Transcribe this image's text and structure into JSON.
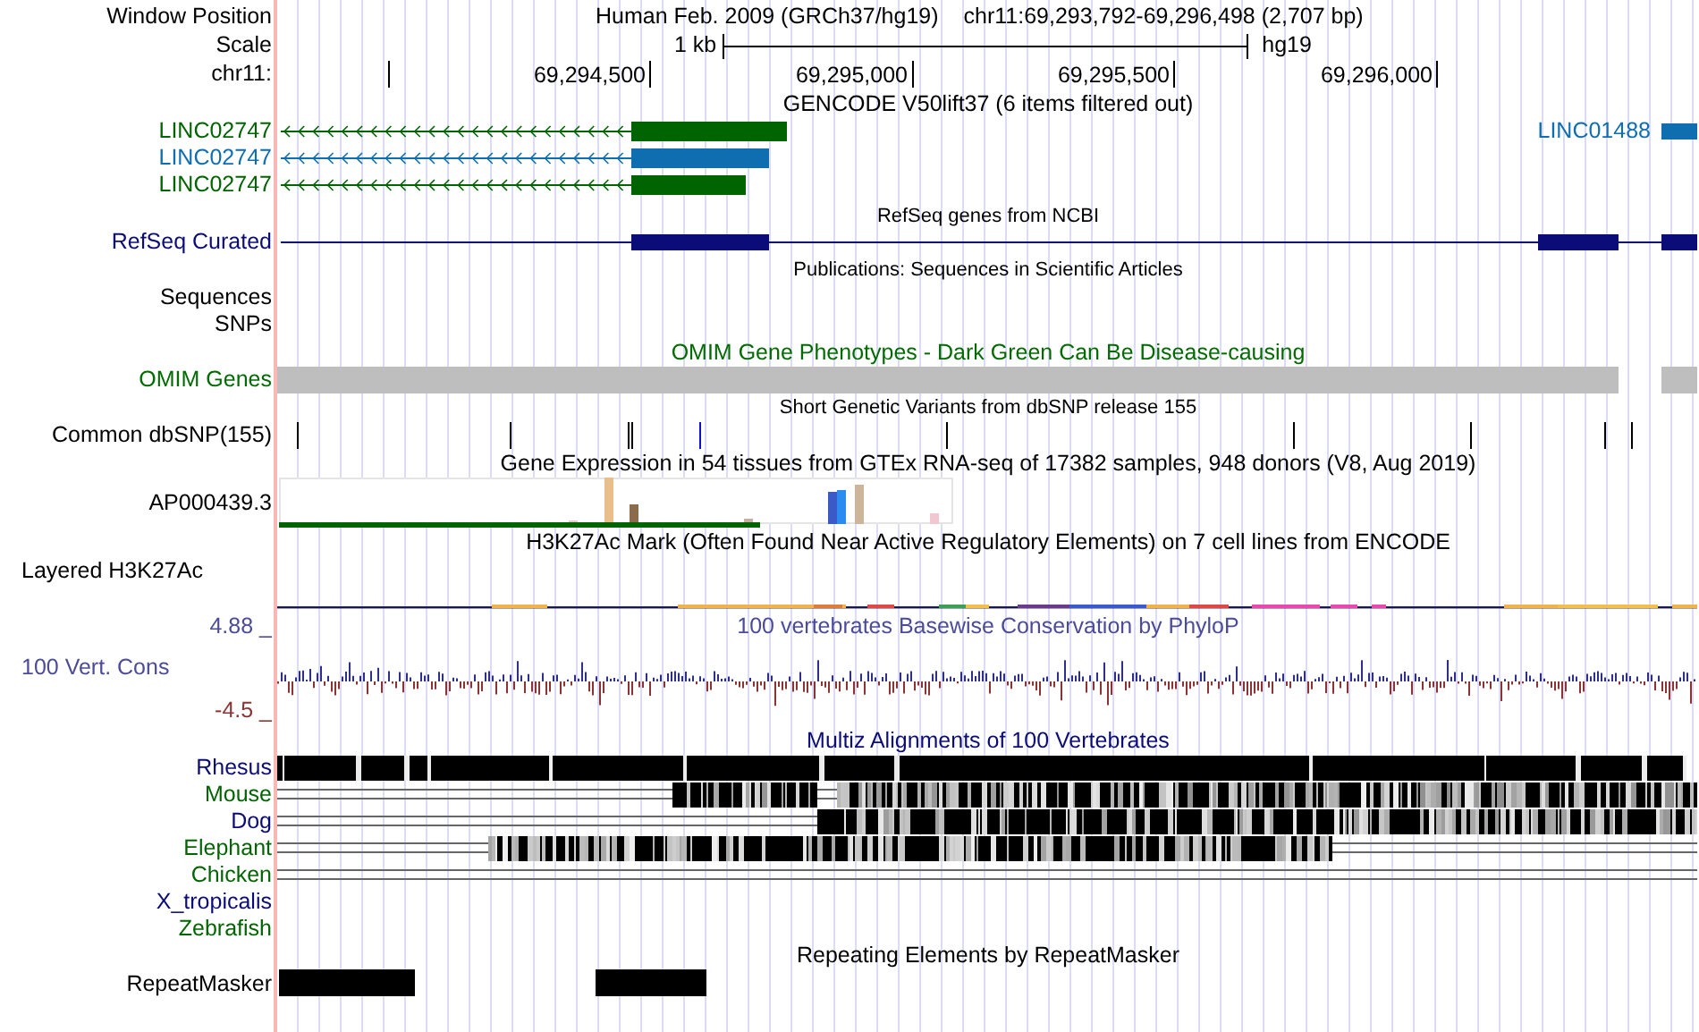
{
  "header": {
    "position_label": "Window Position",
    "assembly": "Human Feb. 2009 (GRCh37/hg19)",
    "position": "chr11:69,293,792-69,296,498 (2,707 bp)",
    "scale_label": "Scale",
    "scale_value": "1 kb",
    "scale_db": "hg19",
    "chrom_label": "chr11:",
    "ticks": [
      "69,294,500",
      "69,295,000",
      "69,295,500",
      "69,296,000"
    ]
  },
  "tracks": [
    {
      "kind": "genes",
      "title": "GENCODE V50lift37 (6 items filtered out)",
      "items": [
        {
          "label": "LINC02747",
          "color": "#006400"
        },
        {
          "label": "LINC02747",
          "color": "#0e6eb0"
        },
        {
          "label": "LINC02747",
          "color": "#006400"
        }
      ],
      "extra": {
        "label": "LINC01488",
        "color": "#0e6eb0"
      }
    },
    {
      "kind": "refseq",
      "title": "RefSeq genes from NCBI",
      "labels": [
        "RefSeq Curated"
      ]
    },
    {
      "kind": "pubs",
      "title": "Publications: Sequences in Scientific Articles",
      "labels": [
        "Sequences",
        "SNPs"
      ]
    },
    {
      "kind": "omim",
      "title": "OMIM Gene Phenotypes - Dark Green Can Be Disease-causing",
      "labels": [
        "OMIM Genes"
      ]
    },
    {
      "kind": "snp",
      "title": "Short Genetic Variants from dbSNP release 155",
      "labels": [
        "Common dbSNP(155)"
      ]
    },
    {
      "kind": "gtex",
      "title": "Gene Expression in 54 tissues from GTEx RNA-seq of 17382 samples, 948 donors (V8, Aug 2019)",
      "labels": [
        "AP000439.3"
      ]
    },
    {
      "kind": "layered",
      "title": "H3K27Ac Mark (Often Found Near Active Regulatory Elements) on 7 cell lines from ENCODE",
      "labels": [
        "Layered H3K27Ac"
      ]
    },
    {
      "kind": "wiggle",
      "title": "100 vertebrates Basewise Conservation by PhyloP",
      "labels": [
        "100 Vert. Cons"
      ],
      "max": "4.88 _",
      "min": "-4.5 _"
    },
    {
      "kind": "multiz",
      "title": "Multiz Alignments of 100 Vertebrates",
      "species": [
        {
          "label": "Rhesus",
          "color": "#0c0c78"
        },
        {
          "label": "Mouse",
          "color": "#006400"
        },
        {
          "label": "Dog",
          "color": "#0c0c78"
        },
        {
          "label": "Elephant",
          "color": "#006400"
        },
        {
          "label": "Chicken",
          "color": "#006400"
        },
        {
          "label": "X_tropicalis",
          "color": "#0c0c78"
        },
        {
          "label": "Zebrafish",
          "color": "#006400"
        }
      ]
    },
    {
      "kind": "repeats",
      "title": "Repeating Elements by RepeatMasker",
      "labels": [
        "RepeatMasker"
      ]
    }
  ]
}
